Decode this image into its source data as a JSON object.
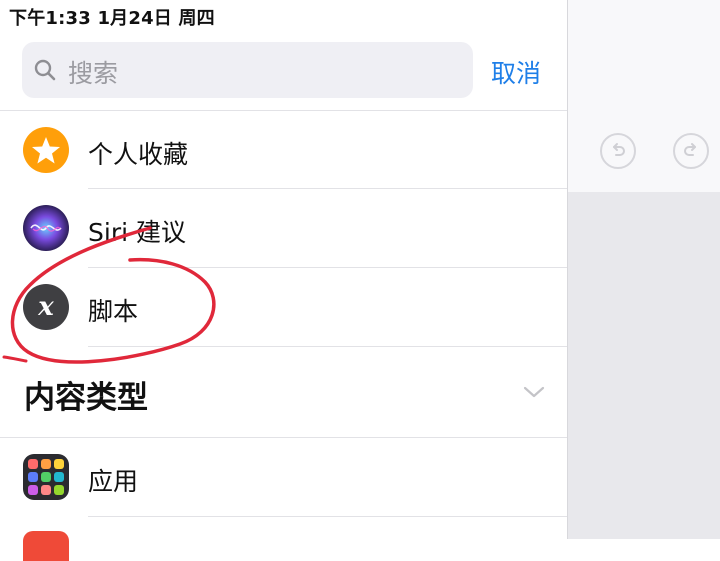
{
  "status_bar": {
    "text": "下午1:33   1月24日 周四"
  },
  "search": {
    "placeholder": "搜索",
    "cancel_label": "取消"
  },
  "rows": [
    {
      "label": "个人收藏",
      "icon": "star-icon",
      "color": "#ff9f0a"
    },
    {
      "label": "Siri 建议",
      "icon": "siri-icon",
      "color": "#2d1f5a"
    },
    {
      "label": "脚本",
      "icon": "script-x-icon",
      "color": "#3f3f42",
      "glyph": "x"
    }
  ],
  "section": {
    "title": "内容类型"
  },
  "content_rows": [
    {
      "label": "应用",
      "icon": "apps-grid-icon"
    }
  ],
  "colors": {
    "accent": "#1f7fe8",
    "annotation": "#e0283a"
  },
  "annotation": "red hand-drawn circle around the 脚本 row"
}
